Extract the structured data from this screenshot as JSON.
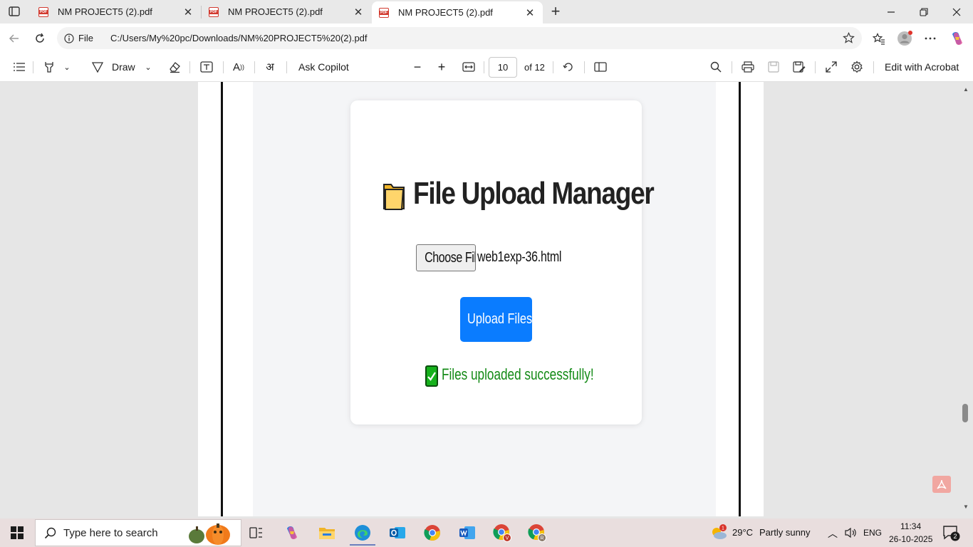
{
  "browser": {
    "tabs": [
      {
        "title": "NM PROJECT5 (2).pdf",
        "active": false
      },
      {
        "title": "NM PROJECT5 (2).pdf",
        "active": false
      },
      {
        "title": "NM PROJECT5 (2).pdf",
        "active": true
      }
    ],
    "address": {
      "scheme": "File",
      "url": "C:/Users/My%20pc/Downloads/NM%20PROJECT5%20(2).pdf"
    }
  },
  "pdf_toolbar": {
    "draw_label": "Draw",
    "ask_copilot_label": "Ask Copilot",
    "current_page": "10",
    "page_total": "of 12",
    "edit_acrobat_label": "Edit with Acrobat"
  },
  "document": {
    "title": "File Upload Manager",
    "choose_button_label": "Choose Files",
    "selected_file": "web1exp-36.html",
    "upload_button_label": "Upload Files",
    "success_message": "Files uploaded successfully!"
  },
  "taskbar": {
    "search_placeholder": "Type here to search",
    "weather_badge": "1",
    "temperature": "29°C",
    "weather_text": "Partly sunny",
    "language": "ENG",
    "time": "11:34",
    "date": "26-10-2025",
    "notification_count": "2",
    "chrome_profile_1": "V",
    "chrome_profile_2": "R"
  },
  "colors": {
    "upload_button": "#0a7cff",
    "success_text": "#138a16",
    "page_background": "#f4f5f7"
  },
  "icons": [
    "tab-actions-icon",
    "pdf-file-icon",
    "close-icon",
    "plus-icon",
    "minimize-icon",
    "restore-icon",
    "back-arrow-icon",
    "refresh-icon",
    "info-icon",
    "star-icon",
    "favorites-icon",
    "profile-avatar-icon",
    "more-icon",
    "copilot-icon",
    "contents-icon",
    "highlight-icon",
    "draw-icon",
    "eraser-icon",
    "text-box-icon",
    "read-aloud-icon",
    "translate-icon",
    "zoom-out-icon",
    "zoom-in-icon",
    "fit-page-icon",
    "rotate-icon",
    "page-view-icon",
    "search-icon",
    "print-icon",
    "save-icon",
    "save-as-icon",
    "fullscreen-icon",
    "settings-icon",
    "folder-icon",
    "check-mark-icon",
    "acrobat-icon",
    "windows-start-icon",
    "task-view-icon",
    "file-explorer-icon",
    "edge-icon",
    "outlook-icon",
    "chrome-icon",
    "word-icon",
    "weather-icon",
    "speaker-icon",
    "notification-icon"
  ]
}
